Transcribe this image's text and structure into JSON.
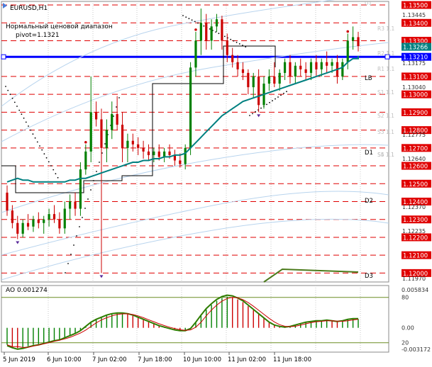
{
  "symbol_label": "EURUSD,H1",
  "indicator_line1": "Нормальный ценовой диапазон",
  "indicator_line2": "pivot=1.1321",
  "ao_label": "AO 0.001274",
  "colors": {
    "grid": "#c8c8c8",
    "level_line": "#e00000",
    "pivot_line": "#0000ff",
    "ma_line": "#008080",
    "bull_candle": "#008000",
    "bear_candle": "#cc0000",
    "price_tag_bg": "#e00000",
    "pivot_tag_bg": "#0000ff",
    "current_tag_bg": "#008080",
    "osc_line": "#2e7d00",
    "osc_signal": "#cc0000"
  },
  "chart_data": [
    {
      "type": "candlestick",
      "title": "EURUSD,H1",
      "y_axis_ticks": [
        "1.13445",
        "1.13175",
        "1.13040",
        "1.12775",
        "1.12640",
        "1.12370",
        "1.12235",
        "1.11970"
      ],
      "level_tags": [
        "1.13500",
        "1.13400",
        "1.13300",
        "1.13266",
        "1.13210",
        "1.13100",
        "1.13000",
        "1.12900",
        "1.12800",
        "1.12700",
        "1.12600",
        "1.12500",
        "1.12400",
        "1.12300",
        "1.12200",
        "1.12100",
        "1.12000"
      ],
      "current_price": "1.13266",
      "pivot_price": "1.13210",
      "level_labels": [
        "LB",
        "D1",
        "D2",
        "D3"
      ],
      "faded_labels": [
        "U1",
        "R3 1.1",
        "R2 1.1",
        "R1 1.1",
        "S1 1.1",
        "S2 1.1",
        "S3 1.1",
        "S4 1.1",
        "S5 1.1"
      ],
      "x_labels": [
        "5 Jun 2019",
        "6 Jun 10:00",
        "7 Jun 02:00",
        "7 Jun 18:00",
        "10 Jun 10:00",
        "11 Jun 02:00",
        "11 Jun 18:00"
      ],
      "ylim": [
        1.1195,
        1.1352
      ],
      "candles": [
        [
          1.1245,
          1.1249,
          1.1232,
          1.1235
        ],
        [
          1.1235,
          1.1238,
          1.1225,
          1.1228
        ],
        [
          1.1228,
          1.1232,
          1.1219,
          1.1222
        ],
        [
          1.1222,
          1.123,
          1.122,
          1.1228
        ],
        [
          1.1228,
          1.1233,
          1.1224,
          1.1226
        ],
        [
          1.1226,
          1.1232,
          1.1223,
          1.123
        ],
        [
          1.123,
          1.1234,
          1.1225,
          1.1228
        ],
        [
          1.1228,
          1.1232,
          1.1222,
          1.123
        ],
        [
          1.123,
          1.1236,
          1.1226,
          1.1233
        ],
        [
          1.1233,
          1.1238,
          1.1228,
          1.123
        ],
        [
          1.123,
          1.1234,
          1.1222,
          1.1225
        ],
        [
          1.1225,
          1.124,
          1.1222,
          1.1236
        ],
        [
          1.1236,
          1.1244,
          1.123,
          1.124
        ],
        [
          1.124,
          1.1245,
          1.1232,
          1.1236
        ],
        [
          1.1236,
          1.1262,
          1.1232,
          1.1258
        ],
        [
          1.1258,
          1.1272,
          1.1255,
          1.1268
        ],
        [
          1.1268,
          1.131,
          1.1262,
          1.129
        ],
        [
          1.129,
          1.1296,
          1.1282,
          1.1286
        ],
        [
          1.1286,
          1.1292,
          1.12,
          1.127
        ],
        [
          1.127,
          1.1286,
          1.1262,
          1.128
        ],
        [
          1.128,
          1.1296,
          1.1275,
          1.1289
        ],
        [
          1.1289,
          1.1299,
          1.128,
          1.1283
        ],
        [
          1.1283,
          1.129,
          1.1262,
          1.127
        ],
        [
          1.127,
          1.1278,
          1.1262,
          1.1274
        ],
        [
          1.1274,
          1.1278,
          1.1268,
          1.1272
        ],
        [
          1.1272,
          1.1276,
          1.1266,
          1.127
        ],
        [
          1.127,
          1.1274,
          1.1264,
          1.1268
        ],
        [
          1.1268,
          1.1272,
          1.1263,
          1.1266
        ],
        [
          1.1266,
          1.127,
          1.1262,
          1.1268
        ],
        [
          1.1268,
          1.1272,
          1.1263,
          1.1265
        ],
        [
          1.1265,
          1.127,
          1.1262,
          1.1268
        ],
        [
          1.1268,
          1.1272,
          1.1264,
          1.1266
        ],
        [
          1.1266,
          1.1269,
          1.126,
          1.1263
        ],
        [
          1.1263,
          1.1267,
          1.1259,
          1.1261
        ],
        [
          1.1261,
          1.1272,
          1.1258,
          1.127
        ],
        [
          1.127,
          1.1318,
          1.1266,
          1.1315
        ],
        [
          1.1315,
          1.1335,
          1.131,
          1.133
        ],
        [
          1.133,
          1.1348,
          1.1322,
          1.134
        ],
        [
          1.134,
          1.1345,
          1.1325,
          1.133
        ],
        [
          1.133,
          1.1342,
          1.1325,
          1.1338
        ],
        [
          1.1338,
          1.1345,
          1.1335,
          1.1342
        ],
        [
          1.1342,
          1.1344,
          1.1325,
          1.133
        ],
        [
          1.133,
          1.1334,
          1.1318,
          1.1322
        ],
        [
          1.1322,
          1.1326,
          1.1315,
          1.1318
        ],
        [
          1.1318,
          1.1322,
          1.131,
          1.1314
        ],
        [
          1.1314,
          1.1318,
          1.1308,
          1.1312
        ],
        [
          1.1312,
          1.1314,
          1.13,
          1.1304
        ],
        [
          1.1304,
          1.1312,
          1.1298,
          1.131
        ],
        [
          1.131,
          1.1314,
          1.129,
          1.1294
        ],
        [
          1.1294,
          1.131,
          1.1292,
          1.1306
        ],
        [
          1.1306,
          1.1314,
          1.1302,
          1.131
        ],
        [
          1.131,
          1.1318,
          1.1304,
          1.1306
        ],
        [
          1.1306,
          1.1314,
          1.1302,
          1.1312
        ],
        [
          1.1312,
          1.132,
          1.1308,
          1.1318
        ],
        [
          1.1318,
          1.1322,
          1.1306,
          1.131
        ],
        [
          1.131,
          1.1318,
          1.1306,
          1.1316
        ],
        [
          1.1316,
          1.132,
          1.131,
          1.1314
        ],
        [
          1.1314,
          1.1318,
          1.1308,
          1.1312
        ],
        [
          1.1312,
          1.132,
          1.1308,
          1.1318
        ],
        [
          1.1318,
          1.1322,
          1.131,
          1.1314
        ],
        [
          1.1314,
          1.132,
          1.131,
          1.1318
        ],
        [
          1.1318,
          1.1324,
          1.1312,
          1.1316
        ],
        [
          1.1316,
          1.132,
          1.1312,
          1.1318
        ],
        [
          1.1318,
          1.1322,
          1.1306,
          1.131
        ],
        [
          1.131,
          1.132,
          1.1308,
          1.1318
        ],
        [
          1.1318,
          1.1334,
          1.1314,
          1.133
        ],
        [
          1.133,
          1.1338,
          1.1325,
          1.1332
        ],
        [
          1.1332,
          1.1335,
          1.1324,
          1.1327
        ]
      ],
      "ma_values": [
        1.1251,
        1.1252,
        1.1253,
        1.1252,
        1.1252,
        1.1251,
        1.1251,
        1.1251,
        1.1251,
        1.1251,
        1.1251,
        1.1251,
        1.1252,
        1.1252,
        1.1253,
        1.1253,
        1.1254,
        1.1255,
        1.1256,
        1.1257,
        1.1258,
        1.1259,
        1.126,
        1.1261,
        1.1262,
        1.1262,
        1.1263,
        1.1263,
        1.1264,
        1.1264,
        1.1265,
        1.1265,
        1.1266,
        1.1266,
        1.1267,
        1.127,
        1.1273,
        1.1276,
        1.1279,
        1.1282,
        1.1285,
        1.1288,
        1.129,
        1.1292,
        1.1294,
        1.1296,
        1.1297,
        1.1298,
        1.1299,
        1.13,
        1.1301,
        1.1302,
        1.1303,
        1.1304,
        1.1305,
        1.1306,
        1.1307,
        1.1308,
        1.1309,
        1.131,
        1.1311,
        1.1312,
        1.1313,
        1.1314,
        1.1315,
        1.1318,
        1.132,
        1.132
      ],
      "ao_ylim": [
        -0.003172,
        0.005834
      ],
      "ao_ticks": [
        "0.005834",
        "80",
        "0.00",
        "20",
        "-0.003172"
      ],
      "ao_values": [
        -0.0025,
        -0.0028,
        -0.003,
        -0.0029,
        -0.0027,
        -0.0025,
        -0.0024,
        -0.0022,
        -0.002,
        -0.0018,
        -0.0017,
        -0.0014,
        -0.0011,
        -0.0008,
        -0.0004,
        0.0002,
        0.0008,
        0.0012,
        0.0015,
        0.0018,
        0.002,
        0.0021,
        0.0021,
        0.002,
        0.0018,
        0.0015,
        0.0012,
        0.0009,
        0.0006,
        0.0003,
        0.0001,
        -0.0001,
        -0.0003,
        -0.0004,
        -0.0004,
        -0.0001,
        0.0008,
        0.0018,
        0.0027,
        0.0034,
        0.004,
        0.0044,
        0.0046,
        0.0045,
        0.0042,
        0.0038,
        0.0032,
        0.0026,
        0.002,
        0.0014,
        0.0008,
        0.0004,
        0.0002,
        0.0001,
        0.0002,
        0.0004,
        0.0006,
        0.0008,
        0.0009,
        0.001,
        0.001,
        0.0011,
        0.001,
        0.0009,
        0.001,
        0.0012,
        0.0013,
        0.0013
      ]
    }
  ]
}
